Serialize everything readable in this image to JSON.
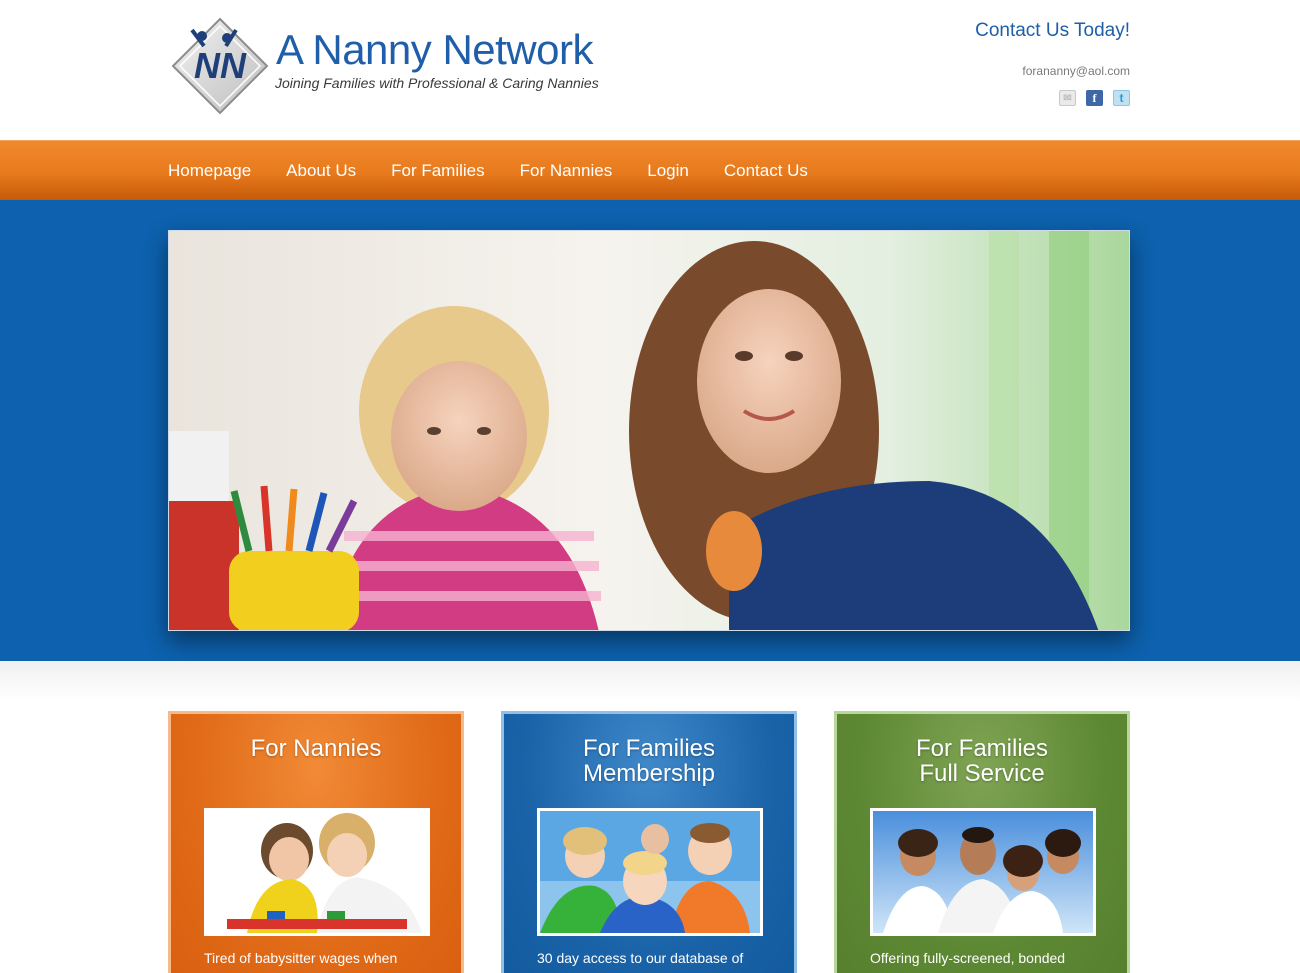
{
  "header": {
    "logo_title": "A Nanny Network",
    "logo_tagline": "Joining Families with Professional & Caring Nannies",
    "logo_mark_text": "NN",
    "contact_heading": "Contact Us Today!",
    "contact_email": "forananny@aol.com",
    "social": [
      {
        "icon": "mail-icon"
      },
      {
        "icon": "facebook-icon",
        "glyph": "f"
      },
      {
        "icon": "twitter-icon",
        "glyph": "t"
      }
    ]
  },
  "nav": {
    "items": [
      "Homepage",
      "About Us",
      "For Families",
      "For Nannies",
      "Login",
      "Contact Us"
    ]
  },
  "hero": {
    "image": "photo of a smiling woman and a toddler coloring with pencils"
  },
  "cards": [
    {
      "title_line1": "For Nannies",
      "title_line2": "",
      "text": "Tired of babysitter wages when",
      "color": "#e06a17"
    },
    {
      "title_line1": "For Families",
      "title_line2": "Membership",
      "text": "30 day access to our database of",
      "color": "#1a63a8"
    },
    {
      "title_line1": "For Families",
      "title_line2": "Full Service",
      "text": "Offering fully-screened, bonded",
      "color": "#5d8833"
    }
  ],
  "colors": {
    "brand_blue": "#1f5ea8",
    "nav_orange": "#e77a1d",
    "hero_blue": "#0d61ae"
  }
}
